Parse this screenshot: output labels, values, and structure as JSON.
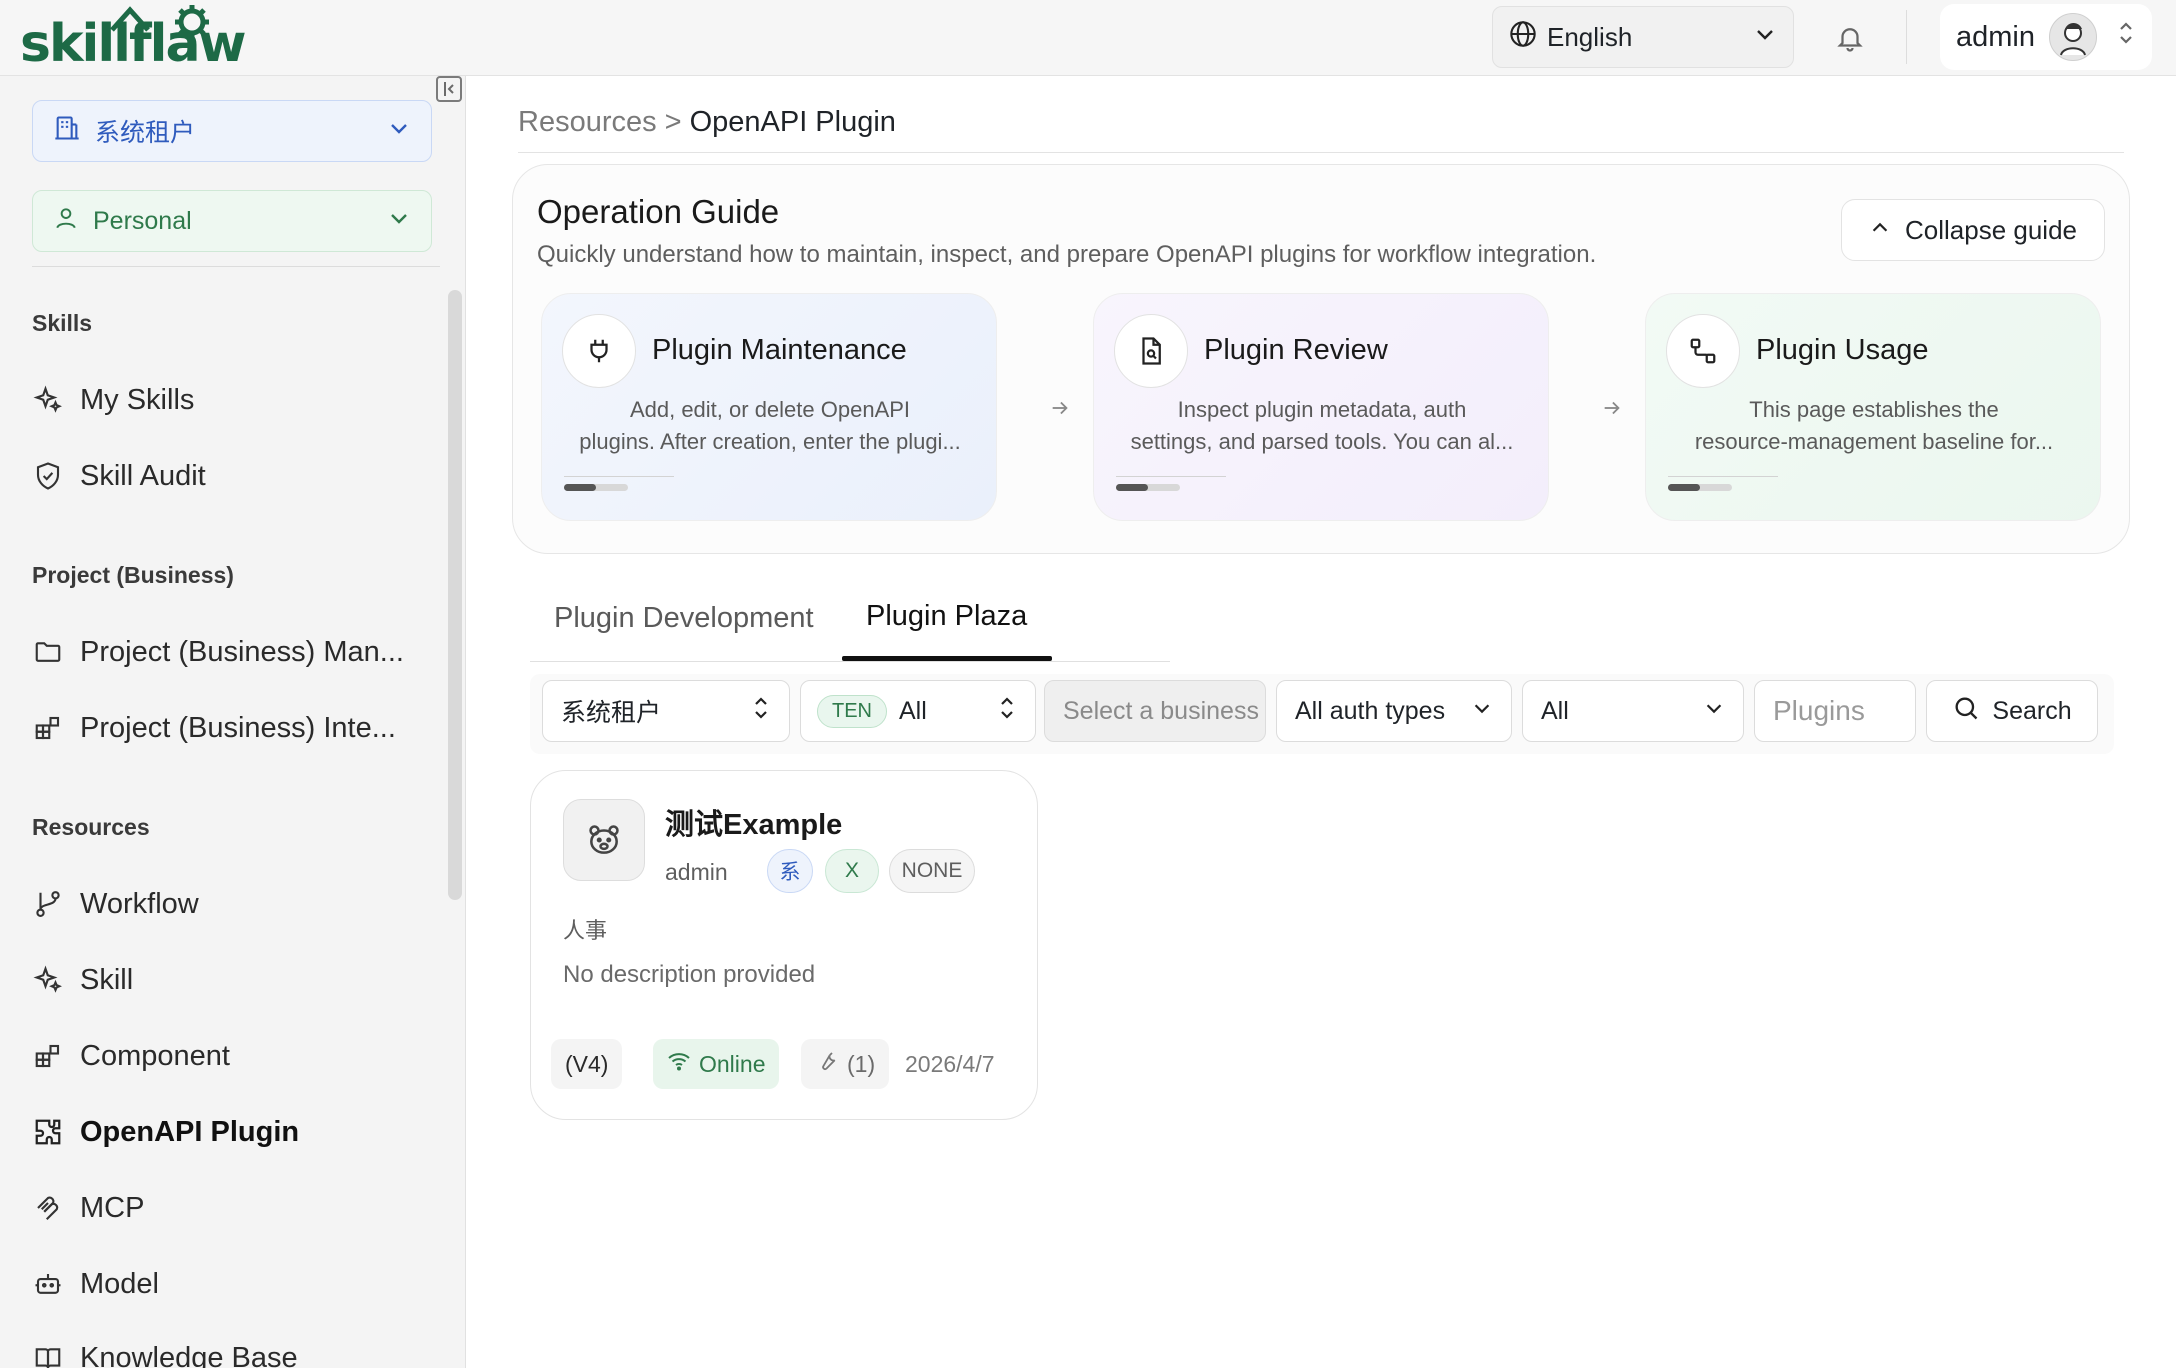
{
  "header": {
    "logo_text": "skillflaw",
    "language": "English",
    "user_name": "admin"
  },
  "sidebar": {
    "tenant_select": "系统租户",
    "space_select": "Personal",
    "sections": [
      {
        "title": "Skills",
        "items": [
          {
            "label": "My Skills",
            "icon": "sparkle-icon"
          },
          {
            "label": "Skill Audit",
            "icon": "shield-check-icon"
          }
        ]
      },
      {
        "title": "Project (Business)",
        "items": [
          {
            "label": "Project (Business) Man...",
            "icon": "folder-icon"
          },
          {
            "label": "Project (Business) Inte...",
            "icon": "blocks-icon"
          }
        ]
      },
      {
        "title": "Resources",
        "items": [
          {
            "label": "Workflow",
            "icon": "branch-icon"
          },
          {
            "label": "Skill",
            "icon": "sparkle-icon"
          },
          {
            "label": "Component",
            "icon": "blocks-icon"
          },
          {
            "label": "OpenAPI Plugin",
            "icon": "puzzle-icon",
            "active": true
          },
          {
            "label": "MCP",
            "icon": "mcp-icon"
          },
          {
            "label": "Model",
            "icon": "robot-icon"
          },
          {
            "label": "Knowledge Base",
            "icon": "book-icon"
          }
        ]
      }
    ]
  },
  "breadcrumb": {
    "parent": "Resources",
    "separator": ">",
    "current": "OpenAPI Plugin"
  },
  "guide": {
    "title": "Operation Guide",
    "subtitle": "Quickly understand how to maintain, inspect, and prepare OpenAPI plugins for workflow integration.",
    "collapse_label": "Collapse guide",
    "cards": [
      {
        "title": "Plugin Maintenance",
        "line1": "Add, edit, or delete OpenAPI",
        "line2": "plugins. After creation, enter the plugi...",
        "icon": "plug-icon"
      },
      {
        "title": "Plugin Review",
        "line1": "Inspect plugin metadata, auth",
        "line2": "settings, and parsed tools. You can al...",
        "icon": "file-search-icon"
      },
      {
        "title": "Plugin Usage",
        "line1": "This page establishes the",
        "line2": "resource-management baseline for...",
        "icon": "flow-icon"
      }
    ]
  },
  "tabs": {
    "development": "Plugin Development",
    "plaza": "Plugin Plaza"
  },
  "filters": {
    "tenant": "系统租户",
    "ten_badge": "TEN",
    "scope": "All",
    "business_placeholder": "Select a business",
    "auth_type": "All auth types",
    "status": "All",
    "search_placeholder": "Plugins",
    "search_button": "Search"
  },
  "plugins": [
    {
      "name": "测试Example",
      "owner": "admin",
      "badge_tenant": "系",
      "badge_x": "X",
      "auth": "NONE",
      "category": "人事",
      "description": "No description provided",
      "version": "(V4)",
      "status": "Online",
      "tools": "(1)",
      "date": "2026/4/7"
    }
  ],
  "colors": {
    "brand_green": "#1d6a46",
    "accent_blue": "#2f5bbd",
    "online_green": "#2f7a4b"
  }
}
